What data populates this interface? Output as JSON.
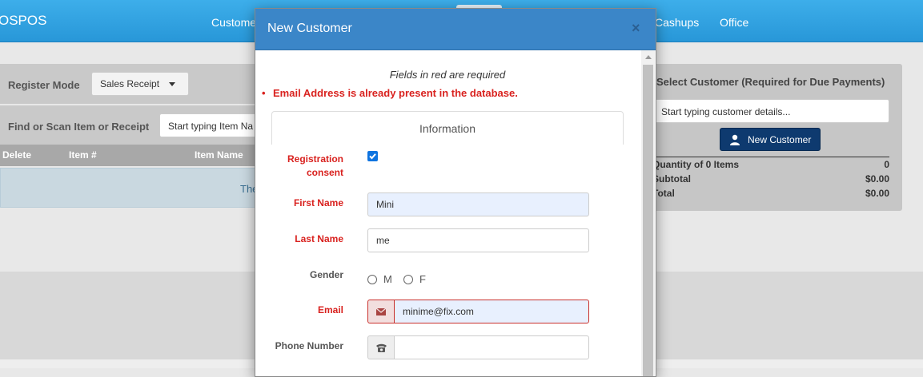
{
  "navbar": {
    "brand": "OSPOS",
    "items": [
      "Custome",
      "Cashups",
      "Office"
    ]
  },
  "register": {
    "mode_label": "Register Mode",
    "mode_value": "Sales Receipt",
    "find_label": "Find or Scan Item or Receipt",
    "find_placeholder": "Start typing Item Na",
    "columns": [
      "Delete",
      "Item #",
      "Item Name"
    ],
    "info_text": "The"
  },
  "customer_panel": {
    "title": "Select Customer (Required for Due Payments)",
    "search_placeholder": "Start typing customer details...",
    "new_customer_button": "New Customer",
    "totals": [
      {
        "label": "Quantity of 0 Items",
        "value": "0"
      },
      {
        "label": "Subtotal",
        "value": "$0.00"
      },
      {
        "label": "Total",
        "value": "$0.00"
      }
    ]
  },
  "modal": {
    "title": "New Customer",
    "close": "×",
    "required_note": "Fields in red are required",
    "error": "Email Address is already present in the database.",
    "tab_label": "Information",
    "fields": {
      "consent_label": "Registration consent",
      "first_name_label": "First Name",
      "first_name_value": "Mini",
      "last_name_label": "Last Name",
      "last_name_value": "me",
      "gender_label": "Gender",
      "gender_m": "M",
      "gender_f": "F",
      "email_label": "Email",
      "email_value": "minime@fix.com",
      "phone_label": "Phone Number",
      "phone_value": ""
    }
  },
  "icons": {
    "email_addon": "envelope-icon",
    "phone_addon": "phone-icon",
    "new_customer": "user-icon"
  },
  "colors": {
    "navbar": "#2897d8",
    "modal_header": "#3b86c8",
    "required": "#d9221f",
    "primary_button": "#0e3a6f",
    "checkbox": "#0f74e0"
  }
}
